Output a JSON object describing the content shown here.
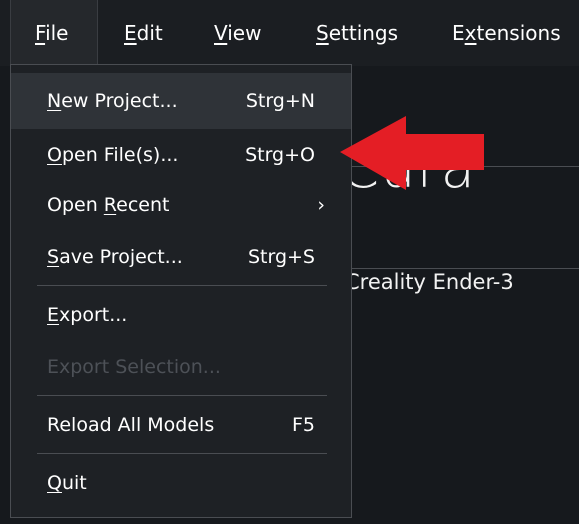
{
  "menubar": {
    "items": [
      {
        "prefix": "",
        "underline": "F",
        "suffix": "ile"
      },
      {
        "prefix": "",
        "underline": "E",
        "suffix": "dit"
      },
      {
        "prefix": "",
        "underline": "V",
        "suffix": "iew"
      },
      {
        "prefix": "",
        "underline": "S",
        "suffix": "ettings"
      },
      {
        "prefix": "E",
        "underline": "x",
        "suffix": "tensions"
      }
    ]
  },
  "background": {
    "app_title": "Cura",
    "printer_name": "Creality Ender-3"
  },
  "file_menu": {
    "items": [
      {
        "prefix": "",
        "underline": "N",
        "suffix": "ew Project...",
        "shortcut": "Strg+N"
      },
      {
        "prefix": "",
        "underline": "O",
        "suffix": "pen File(s)...",
        "shortcut": "Strg+O"
      },
      {
        "prefix": "Open ",
        "underline": "R",
        "suffix": "ecent",
        "shortcut": "›"
      },
      {
        "prefix": "",
        "underline": "S",
        "suffix": "ave Project...",
        "shortcut": "Strg+S"
      },
      {
        "prefix": "",
        "underline": "E",
        "suffix": "xport...",
        "shortcut": ""
      },
      {
        "prefix": "Export Selection...",
        "underline": "",
        "suffix": "",
        "shortcut": ""
      },
      {
        "prefix": "Reload All Models",
        "underline": "",
        "suffix": "",
        "shortcut": "F5"
      },
      {
        "prefix": "",
        "underline": "Q",
        "suffix": "uit",
        "shortcut": ""
      }
    ]
  },
  "colors": {
    "arrow": "#e41e25",
    "menu_bg": "#1e2125",
    "highlight": "#2f3338",
    "disabled_text": "#4d5157"
  }
}
